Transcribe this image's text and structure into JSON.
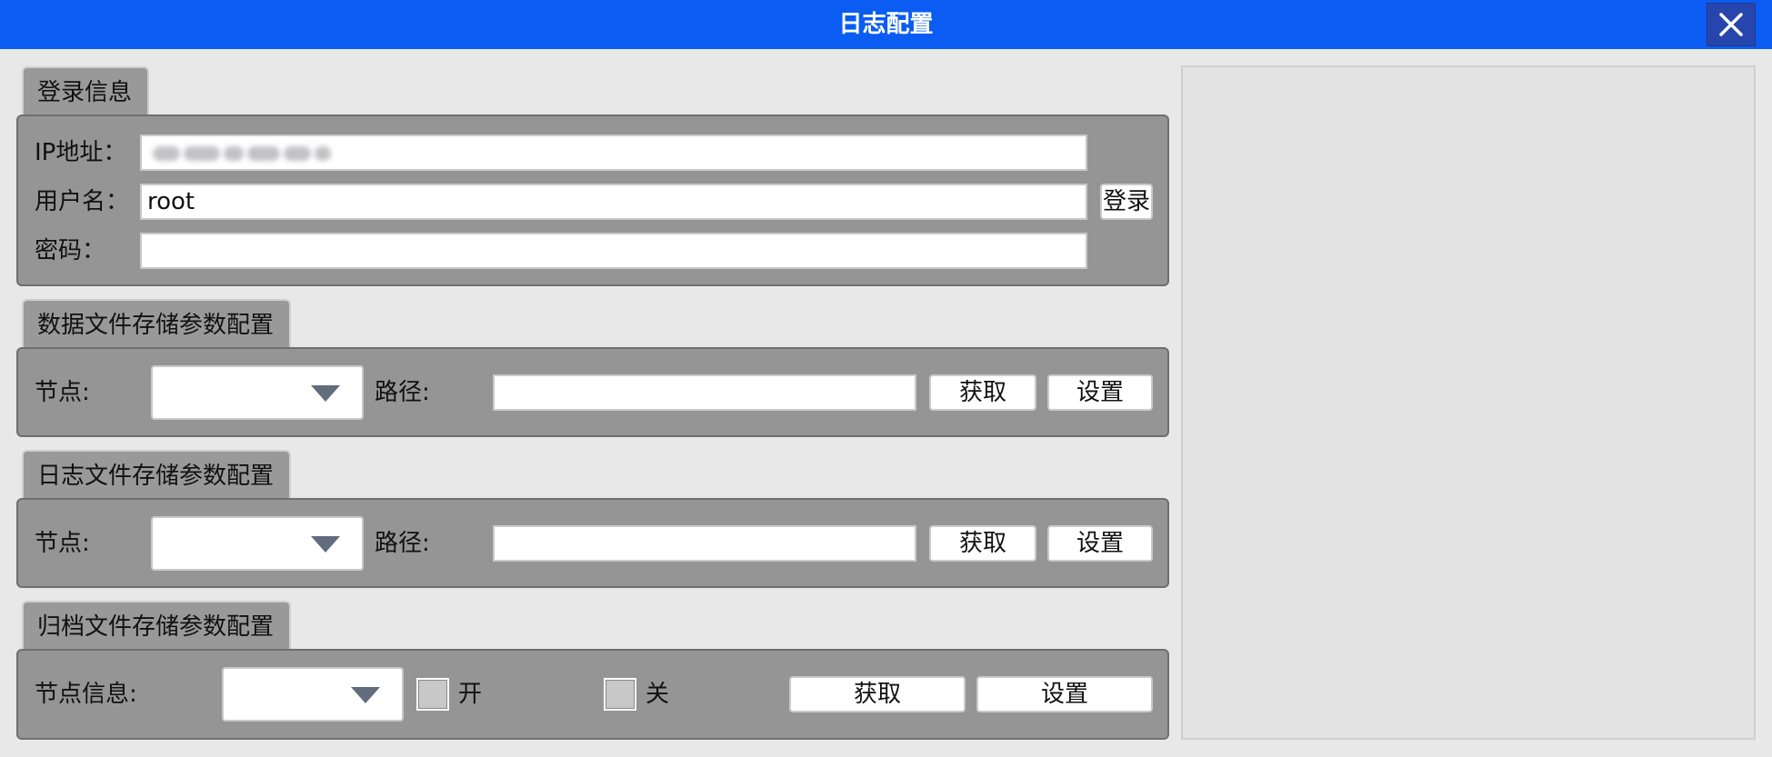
{
  "window": {
    "title": "日志配置",
    "close_label": "×"
  },
  "login": {
    "tab_label": "登录信息",
    "ip_label": "IP地址：",
    "ip_value": "",
    "username_label": "用户名：",
    "username_value": "root",
    "password_label": "密码：",
    "password_value": "",
    "login_button": "登录"
  },
  "data_storage": {
    "tab_label": "数据文件存储参数配置",
    "node_label": "节点:",
    "node_value": "",
    "path_label": "路径:",
    "path_value": "",
    "get_button": "获取",
    "set_button": "设置"
  },
  "log_storage": {
    "tab_label": "日志文件存储参数配置",
    "node_label": "节点:",
    "node_value": "",
    "path_label": "路径:",
    "path_value": "",
    "get_button": "获取",
    "set_button": "设置"
  },
  "archive_storage": {
    "tab_label": "归档文件存储参数配置",
    "node_info_label": "节点信息:",
    "node_value": "",
    "on_label": "开",
    "on_checked": false,
    "off_label": "关",
    "off_checked": false,
    "get_button": "获取",
    "set_button": "设置"
  },
  "colors": {
    "titlebar": "#0a5cf2",
    "close_button": "#2646ad",
    "panel": "#959595",
    "background": "#e8e8e8"
  },
  "icons": {
    "close": "close-icon",
    "dropdown": "triangle-down-icon"
  }
}
